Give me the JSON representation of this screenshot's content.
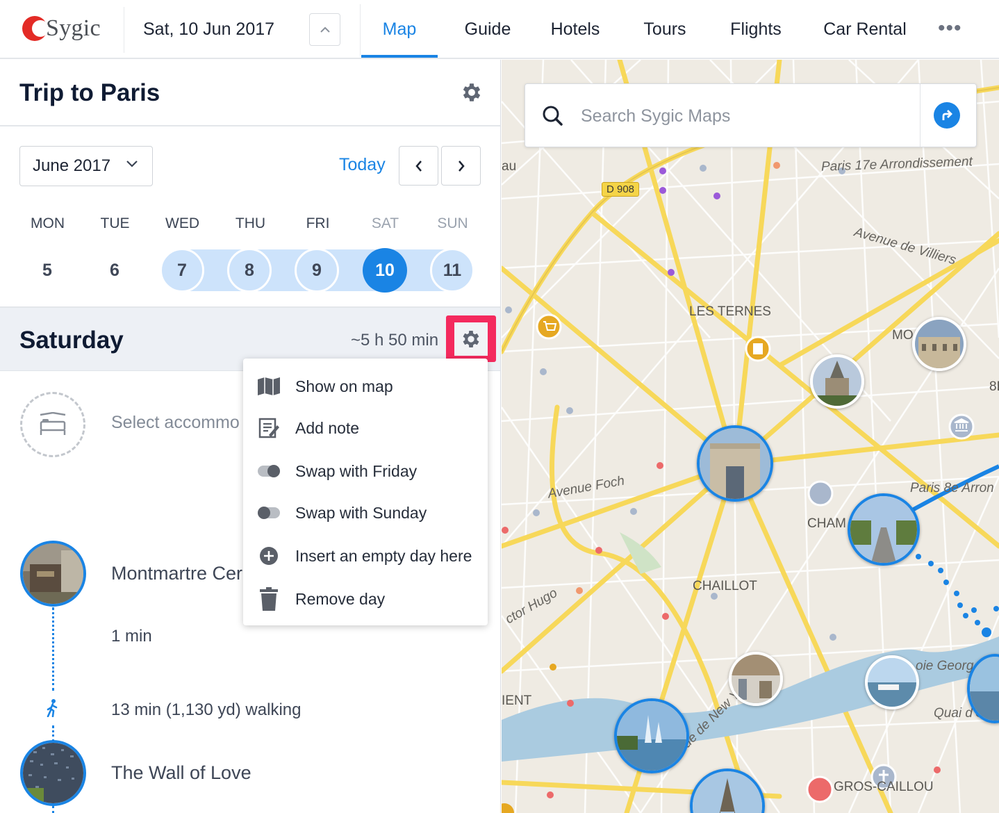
{
  "header": {
    "logo_text": "Sygic",
    "date": "Sat, 10 Jun 2017",
    "nav": [
      {
        "label": "Map",
        "active": true
      },
      {
        "label": "Guide"
      },
      {
        "label": "Hotels"
      },
      {
        "label": "Tours"
      },
      {
        "label": "Flights"
      },
      {
        "label": "Car Rental"
      }
    ],
    "more": "•••"
  },
  "trip": {
    "title": "Trip to Paris"
  },
  "calendar": {
    "month": "June 2017",
    "today": "Today",
    "weekdays": [
      "MON",
      "TUE",
      "WED",
      "THU",
      "FRI",
      "SAT",
      "SUN"
    ],
    "days": [
      "5",
      "6",
      "7",
      "8",
      "9",
      "10",
      "11"
    ],
    "trip_days": [
      "7",
      "8",
      "9",
      "10",
      "11"
    ],
    "selected_day": "10"
  },
  "day": {
    "title": "Saturday",
    "duration": "~5 h 50 min",
    "accommodation_label": "Select accommo",
    "places": [
      {
        "name": "Montmartre Cer"
      },
      {
        "name": "The Wall of Love"
      }
    ],
    "stay_time": "1 min",
    "walking": "13 min (1,130 yd) walking"
  },
  "menu": {
    "items": [
      {
        "label": "Show on map",
        "icon": "map-icon"
      },
      {
        "label": "Add note",
        "icon": "note-icon"
      },
      {
        "label": "Swap with Friday",
        "icon": "toggle-icon"
      },
      {
        "label": "Swap with Sunday",
        "icon": "toggle-icon"
      },
      {
        "label": "Insert an empty day here",
        "icon": "plus-circle-icon"
      },
      {
        "label": "Remove day",
        "icon": "trash-icon"
      }
    ]
  },
  "map": {
    "search_placeholder": "Search Sygic Maps",
    "labels": {
      "arrondissement17": "Paris 17e Arrondissement",
      "villiers": "Avenue de Villiers",
      "ternes": "LES TERNES",
      "foch": "Avenue Foch",
      "paris8": "Paris 8e Arron",
      "champs": "CHAM",
      "chaillot": "CHAILLOT",
      "hugo": "ctor Hugo",
      "newyork": "Avenue de New Yo",
      "quai": "Quai d'O",
      "george": "oie Georg",
      "gros": "GROS-CAILLOU",
      "ent": "IENT",
      "mo": "MO",
      "eight": "8E",
      "au": "au",
      "d908": "D 908"
    }
  },
  "colors": {
    "accent": "#1a84e4",
    "highlight": "#f42a5e",
    "brand": "#e32b26"
  }
}
